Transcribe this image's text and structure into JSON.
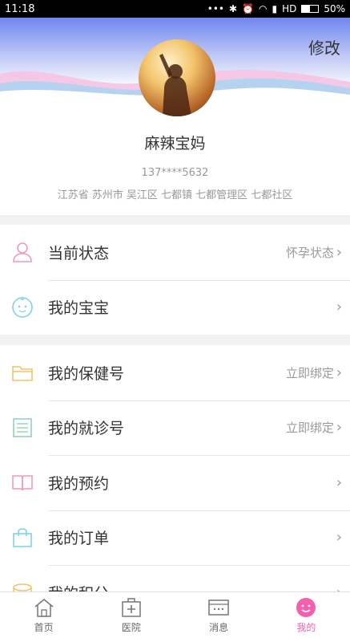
{
  "status_bar": {
    "time": "11:18",
    "signal_text": "HD",
    "battery": "50%"
  },
  "profile": {
    "edit_label": "修改",
    "name": "麻辣宝妈",
    "phone": "137****5632",
    "address": "江苏省 苏州市 吴江区 七都镇 七都管理区 七都社区"
  },
  "group1": [
    {
      "label": "当前状态",
      "value": "怀孕状态",
      "icon": "person-icon"
    },
    {
      "label": "我的宝宝",
      "value": "",
      "icon": "baby-face-icon"
    }
  ],
  "group2": [
    {
      "label": "我的保健号",
      "value": "立即绑定",
      "icon": "folder-icon"
    },
    {
      "label": "我的就诊号",
      "value": "立即绑定",
      "icon": "document-icon"
    },
    {
      "label": "我的预约",
      "value": "",
      "icon": "book-icon"
    },
    {
      "label": "我的订单",
      "value": "",
      "icon": "shopping-bag-icon"
    },
    {
      "label": "我的积分",
      "value": "",
      "icon": "coins-icon"
    }
  ],
  "tabs": [
    {
      "label": "首页",
      "icon": "home-icon"
    },
    {
      "label": "医院",
      "icon": "hospital-icon"
    },
    {
      "label": "消息",
      "icon": "message-icon"
    },
    {
      "label": "我的",
      "icon": "smiley-icon"
    }
  ],
  "colors": {
    "accent_pink": "#f45fae",
    "wave_blue": "#a9c6f5",
    "wave_pink": "#f6c3e4"
  }
}
